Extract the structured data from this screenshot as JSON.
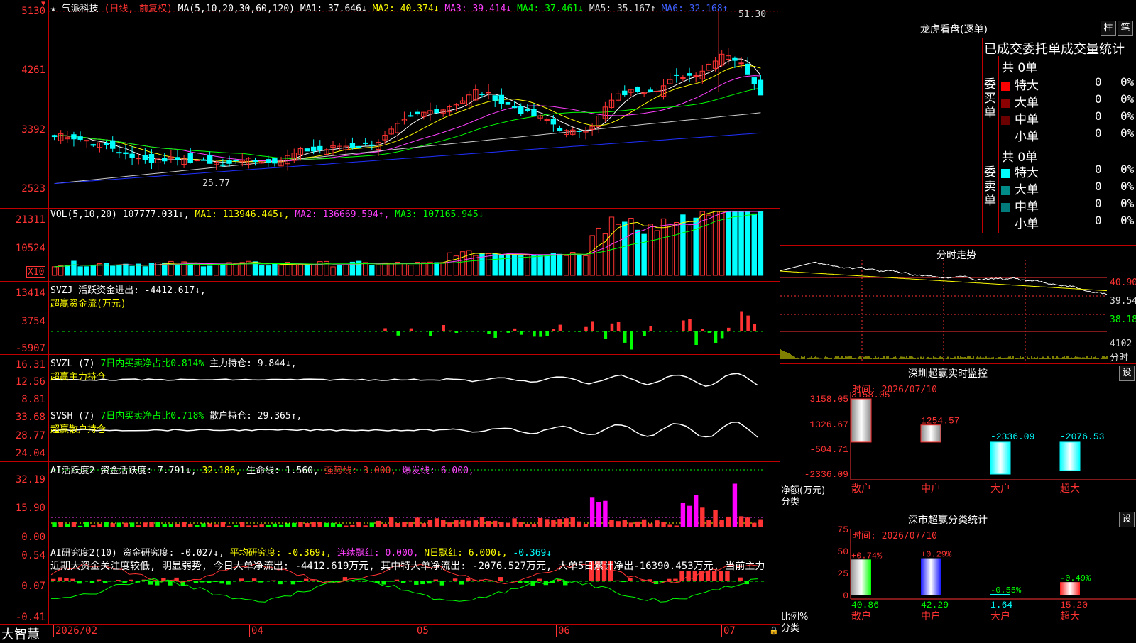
{
  "stock": {
    "title": "气派科技",
    "mode": "(日线, 前复权)",
    "ma_header": "MA(5,10,20,30,60,120)",
    "ma": [
      {
        "label": "MA1: 37.646↓",
        "color": "#ffffff"
      },
      {
        "label": "MA2: 40.374↓",
        "color": "#ffff00"
      },
      {
        "label": "MA3: 39.414↓",
        "color": "#ff40ff"
      },
      {
        "label": "MA4: 37.461↓",
        "color": "#00ff00"
      },
      {
        "label": "MA5: 35.167↑",
        "color": "#dddddd"
      },
      {
        "label": "MA6: 32.168↑",
        "color": "#4060ff"
      }
    ],
    "high_label": "51.30",
    "low_label": "25.77",
    "price_ticks": [
      "5130",
      "4261",
      "3392",
      "2523"
    ]
  },
  "volume": {
    "header": "VOL(5,10,20)",
    "value": "107777.031↓,",
    "ma1": "MA1: 113946.445↓,",
    "ma2": "MA2: 136669.594↑,",
    "ma3": "MA3: 107165.945↓",
    "ticks": [
      "21311",
      "10524"
    ],
    "unit": "X10"
  },
  "svzj": {
    "header": "SVZJ  活跃资金进出: -4412.617↓,",
    "sub": "超赢资金流(万元)",
    "ticks": [
      "13414",
      "3754",
      "-5907"
    ]
  },
  "svzl": {
    "h1": "SVZL (7)",
    "h2": "7日内买卖净占比0.814%",
    "h3": "主力持仓: 9.844↓,",
    "sub": "超赢主力持仓",
    "ticks": [
      "16.31",
      "12.56",
      "8.81"
    ]
  },
  "svsh": {
    "h1": "SVSH (7)",
    "h2": "7日内买卖净占比0.718%",
    "h3": "散户持仓: 29.365↑,",
    "sub": "超赢散户持仓",
    "ticks": [
      "33.68",
      "28.77",
      "24.04"
    ]
  },
  "ai1": {
    "h1": "AI活跃度2",
    "h2": "资金活跃度: 7.791↓,",
    "h3": "32.186,",
    "h4": "生命线: 1.560,",
    "h5": "强势线: 3.000,",
    "h6": "爆发线: 6.000,",
    "ticks": [
      "32.19",
      "15.90",
      "0.00"
    ]
  },
  "ai2": {
    "h1": "AI研究度2(10)",
    "h2": "资金研究度: -0.027↓,",
    "h3": "平均研究度: -0.369↓,",
    "h4": "连续飘红: 0.000,",
    "h5": "N日飘红: 6.000↓,",
    "h6": "-0.369↓",
    "comment": "近期大资金关注度较低, 明显弱势, 今日大单净流出: -4412.619万元, 其中特大单净流出: -2076.527万元, 大单5日累计净出-16390.453万元, 当前主力",
    "ticks": [
      "0.54",
      "0.07",
      "-0.41"
    ]
  },
  "xaxis": {
    "labels": [
      "2026/02",
      "04",
      "05",
      "06",
      "07"
    ]
  },
  "brand": "大智慧",
  "lhb": {
    "title": "龙虎看盘(逐单)",
    "btn_bar": "柱",
    "btn_pen": "笔",
    "tabs": "已成交委托单成交量统计",
    "buy_label": "委买单",
    "sell_label": "委卖单",
    "buy_total": "共 0单",
    "sell_total": "共 0单",
    "buy_rows": [
      {
        "name": "特大",
        "qty": "0",
        "pct": "0%",
        "color": "#ff0000"
      },
      {
        "name": "大单",
        "qty": "0",
        "pct": "0%",
        "color": "#8b0000"
      },
      {
        "name": "中单",
        "qty": "0",
        "pct": "0%",
        "color": "#6b0000"
      },
      {
        "name": "小单",
        "qty": "0",
        "pct": "0%",
        "color": "#000000"
      }
    ],
    "sell_rows": [
      {
        "name": "特大",
        "qty": "0",
        "pct": "0%",
        "color": "#00ffff"
      },
      {
        "name": "大单",
        "qty": "0",
        "pct": "0%",
        "color": "#008b8b"
      },
      {
        "name": "中单",
        "qty": "0",
        "pct": "0%",
        "color": "#007a7a"
      },
      {
        "name": "小单",
        "qty": "0",
        "pct": "0%",
        "color": "#000000"
      }
    ]
  },
  "intraday": {
    "title": "分时走势",
    "ticks": [
      "40.90",
      "39.54",
      "38.18"
    ],
    "vol_tick": "4102",
    "vol_unit": "分时"
  },
  "monitor": {
    "title": "深圳超赢实时监控",
    "btn": "设",
    "time": "时间: 2026/07/10",
    "ticks": [
      "3158.05",
      "1326.67",
      "-504.71",
      "-2336.09"
    ],
    "ylabel": "净额(万元)",
    "xlabel": "分类",
    "categories": [
      "散户",
      "中户",
      "大户",
      "超大"
    ],
    "values": [
      3158.05,
      1254.57,
      -2336.09,
      -2076.53
    ],
    "value_labels": [
      "3158.05",
      "1254.57",
      "-2336.09",
      "-2076.53"
    ]
  },
  "classify": {
    "title": "深市超赢分类统计",
    "btn": "设",
    "time": "时间: 2026/07/10",
    "ticks": [
      "75",
      "50",
      "25",
      "0"
    ],
    "ylabel": "比例%",
    "xlabel": "分类",
    "categories": [
      "散户",
      "中户",
      "大户",
      "超大"
    ],
    "values": [
      40.86,
      42.29,
      1.64,
      15.2
    ],
    "value_labels": [
      "40.86",
      "42.29",
      "1.64",
      "15.20"
    ],
    "change_labels": [
      "+0.74%",
      "+0.29%",
      "-0.55%",
      "-0.49%"
    ]
  },
  "chart_data": [
    {
      "type": "bar",
      "title": "深圳超赢实时监控",
      "categories": [
        "散户",
        "中户",
        "大户",
        "超大"
      ],
      "values": [
        3158.05,
        1254.57,
        -2336.09,
        -2076.53
      ],
      "ylabel": "净额(万元)",
      "xlabel": "分类",
      "ylim": [
        -2336.09,
        3158.05
      ]
    },
    {
      "type": "bar",
      "title": "深市超赢分类统计",
      "categories": [
        "散户",
        "中户",
        "大户",
        "超大"
      ],
      "values": [
        40.86,
        42.29,
        1.64,
        15.2
      ],
      "ylabel": "比例%",
      "xlabel": "分类",
      "ylim": [
        0,
        75
      ]
    }
  ]
}
